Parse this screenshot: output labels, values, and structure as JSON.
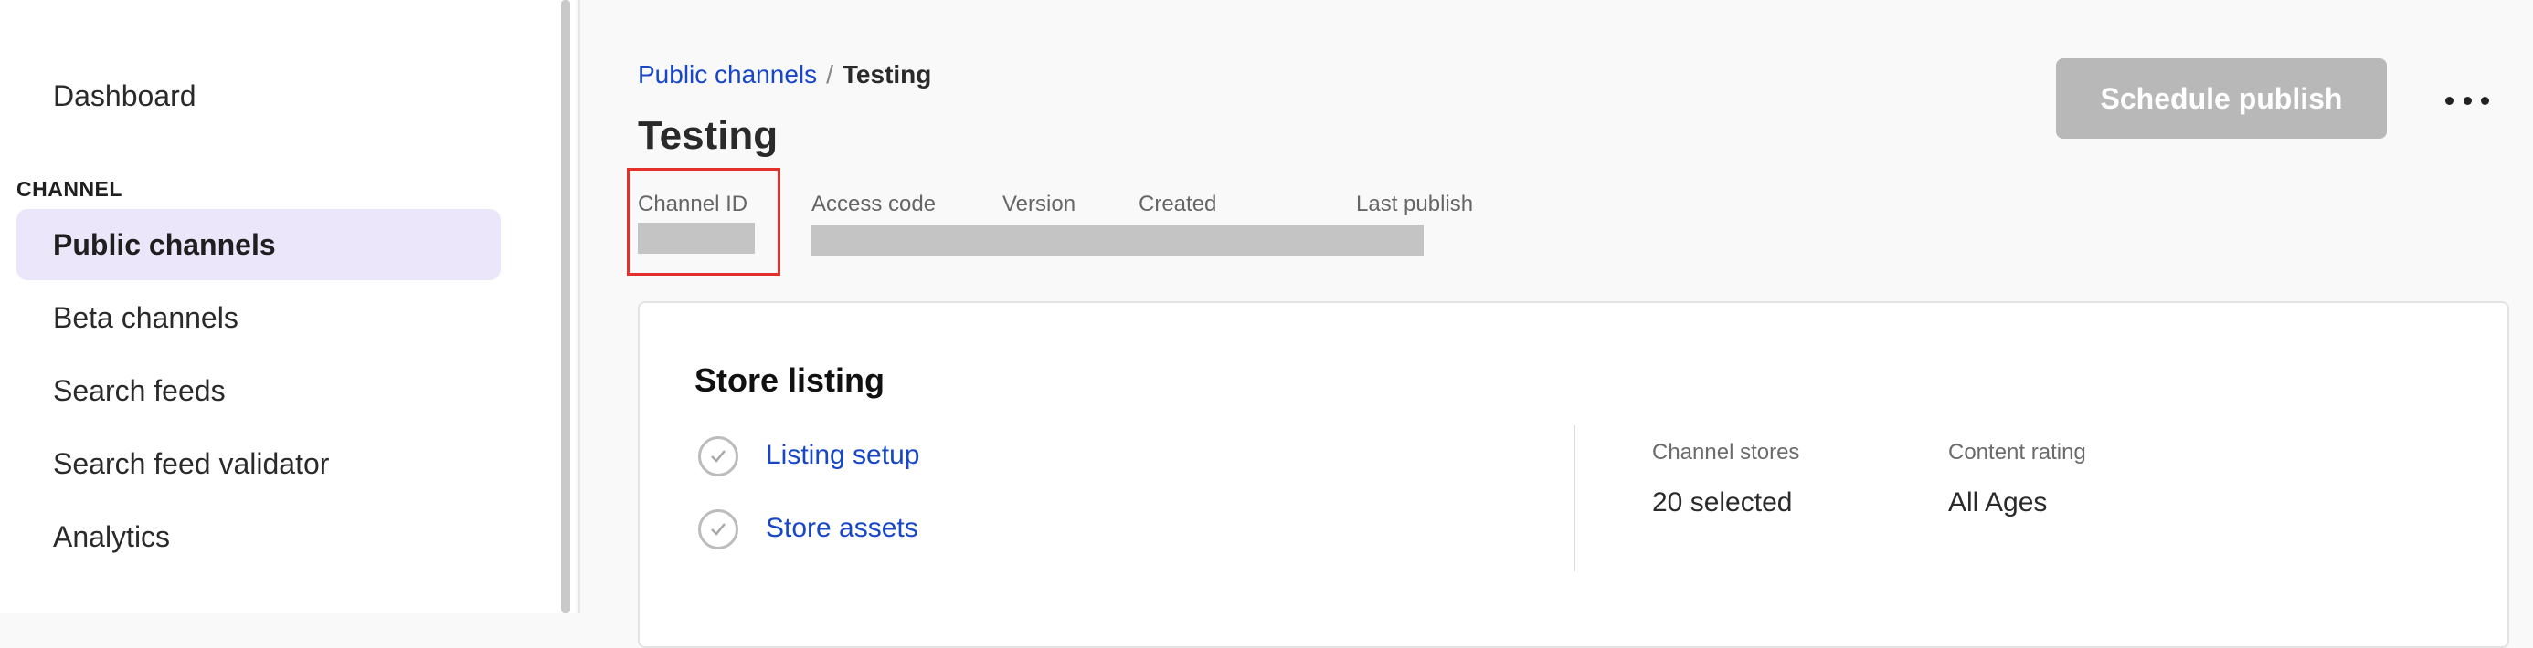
{
  "sidebar": {
    "dashboard": "Dashboard",
    "section_label": "CHANNEL",
    "items": [
      {
        "label": "Public channels"
      },
      {
        "label": "Beta channels"
      },
      {
        "label": "Search feeds"
      },
      {
        "label": "Search feed validator"
      },
      {
        "label": "Analytics"
      }
    ]
  },
  "header": {
    "breadcrumb_parent": "Public channels",
    "breadcrumb_separator": "/",
    "breadcrumb_current": "Testing",
    "title": "Testing",
    "schedule_label": "Schedule publish",
    "meta_labels": [
      "Channel ID",
      "Access code",
      "Version",
      "Created",
      "Last publish"
    ]
  },
  "store_listing": {
    "title": "Store listing",
    "links": [
      "Listing setup",
      "Store assets"
    ],
    "channel_stores_label": "Channel stores",
    "channel_stores_value": "20 selected",
    "content_rating_label": "Content rating",
    "content_rating_value": "All Ages"
  },
  "colors": {
    "link": "#1746c7",
    "active_nav_bg": "#ece6fa",
    "highlight": "#e2312b",
    "disabled_button": "#b8b8b8"
  }
}
